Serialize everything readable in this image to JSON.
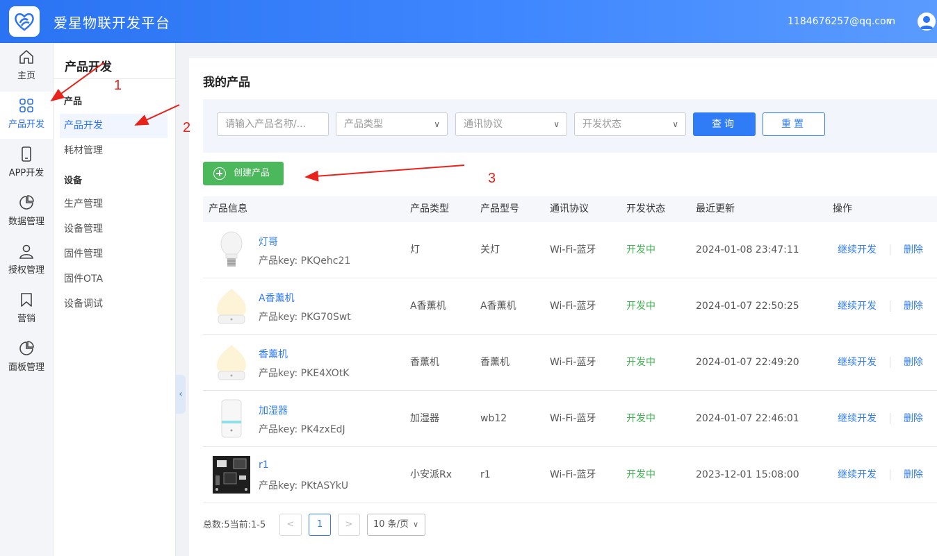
{
  "header": {
    "title": "爱星物联开发平台",
    "user_email": "1184676257@qq.com",
    "user_chevron": "∨"
  },
  "nav": {
    "items": [
      {
        "label": "主页",
        "icon": "home-icon"
      },
      {
        "label": "产品开发",
        "icon": "grid-icon",
        "active": true
      },
      {
        "label": "APP开发",
        "icon": "phone-icon"
      },
      {
        "label": "数据管理",
        "icon": "pie-chart-icon"
      },
      {
        "label": "授权管理",
        "icon": "user-icon"
      },
      {
        "label": "营销",
        "icon": "bookmark-icon"
      },
      {
        "label": "面板管理",
        "icon": "pie-chart-icon"
      }
    ]
  },
  "subnav": {
    "title": "产品开发",
    "group_product": "产品",
    "group_device": "设备",
    "items": [
      "产品开发",
      "耗材管理",
      "生产管理",
      "设备管理",
      "固件管理",
      "固件OTA",
      "设备调试"
    ]
  },
  "main": {
    "title": "我的产品",
    "filters": {
      "name_placeholder": "请输入产品名称/...",
      "type_placeholder": "产品类型",
      "protocol_placeholder": "通讯协议",
      "status_placeholder": "开发状态",
      "query_label": "查询",
      "reset_label": "重置"
    },
    "create_label": "创建产品",
    "columns": [
      "产品信息",
      "产品类型",
      "产品型号",
      "通讯协议",
      "开发状态",
      "最近更新",
      "操作"
    ],
    "rows": [
      {
        "name": "灯哥",
        "key": "产品key: PKQehc21",
        "type": "灯",
        "model": "关灯",
        "protocol": "Wi-Fi-蓝牙",
        "status": "开发中",
        "updated": "2024-01-08 23:47:11",
        "op_continue": "继续开发",
        "op_delete": "删除",
        "image": "bulb"
      },
      {
        "name": "A香薰机",
        "key": "产品key: PKG70Swt",
        "type": "A香薰机",
        "model": "A香薰机",
        "protocol": "Wi-Fi-蓝牙",
        "status": "开发中",
        "updated": "2024-01-07 22:50:25",
        "op_continue": "继续开发",
        "op_delete": "删除",
        "image": "diffuser"
      },
      {
        "name": "香薰机",
        "key": "产品key: PKE4XOtK",
        "type": "香薰机",
        "model": "香薰机",
        "protocol": "Wi-Fi-蓝牙",
        "status": "开发中",
        "updated": "2024-01-07 22:49:20",
        "op_continue": "继续开发",
        "op_delete": "删除",
        "image": "diffuser"
      },
      {
        "name": "加湿器",
        "key": "产品key: PK4zxEdJ",
        "type": "加湿器",
        "model": "wb12",
        "protocol": "Wi-Fi-蓝牙",
        "status": "开发中",
        "updated": "2024-01-07 22:46:01",
        "op_continue": "继续开发",
        "op_delete": "删除",
        "image": "humidifier"
      },
      {
        "name": "r1",
        "key": "产品key: PKtASYkU",
        "type": "小安派Rx",
        "model": "r1",
        "protocol": "Wi-Fi-蓝牙",
        "status": "开发中",
        "updated": "2023-12-01 15:08:00",
        "op_continue": "继续开发",
        "op_delete": "删除",
        "image": "board"
      }
    ],
    "pagination": {
      "total_text": "总数:5当前:1-5",
      "prev": "<",
      "current_page": "1",
      "next": ">",
      "page_size": "10 条/页",
      "page_size_chevron": "∨"
    }
  },
  "annotations": {
    "one": "1",
    "two": "2",
    "three": "3"
  },
  "colors": {
    "primary": "#2f7cf6",
    "success": "#4cb85c",
    "annotation": "#e8231b"
  }
}
